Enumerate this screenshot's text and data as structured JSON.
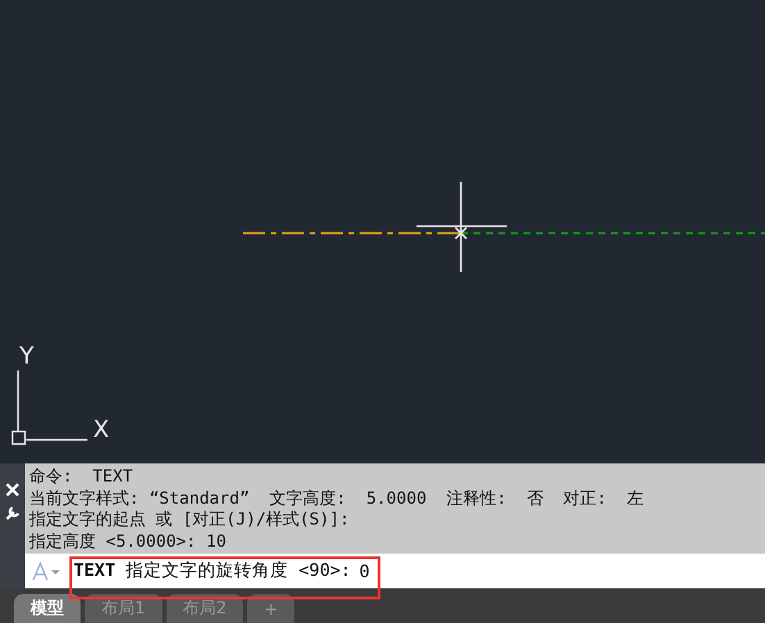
{
  "ucs": {
    "x_label": "X",
    "y_label": "Y"
  },
  "command_history": [
    "命令:  TEXT",
    "当前文字样式: “Standard”  文字高度:  5.0000  注释性:  否  对正:  左",
    "指定文字的起点 或 [对正(J)/样式(S)]:",
    "指定高度 <5.0000>: 10"
  ],
  "command_line": {
    "prompt": "**TEXT** 指定文字的旋转角度 <90>:",
    "value": "0"
  },
  "tabs": [
    {
      "label": "模型",
      "selected": true
    },
    {
      "label": "布局1",
      "selected": false
    },
    {
      "label": "布局2",
      "selected": false
    },
    {
      "label": "+",
      "selected": false
    }
  ]
}
